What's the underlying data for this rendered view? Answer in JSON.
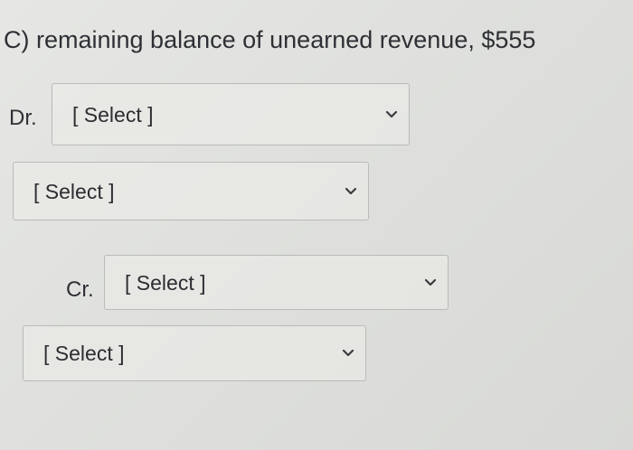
{
  "question": {
    "text": "C) remaining balance of unearned revenue, $555"
  },
  "rows": [
    {
      "label": "Dr.",
      "select": {
        "value": "[ Select ]",
        "icon": "chevron-down-icon"
      }
    },
    {
      "label": "",
      "select": {
        "value": "[ Select ]",
        "icon": "chevron-down-icon"
      }
    },
    {
      "label": "Cr.",
      "select": {
        "value": "[ Select ]",
        "icon": "chevron-down-icon"
      }
    },
    {
      "label": "",
      "select": {
        "value": "[ Select ]",
        "icon": "chevron-down-icon"
      }
    }
  ]
}
